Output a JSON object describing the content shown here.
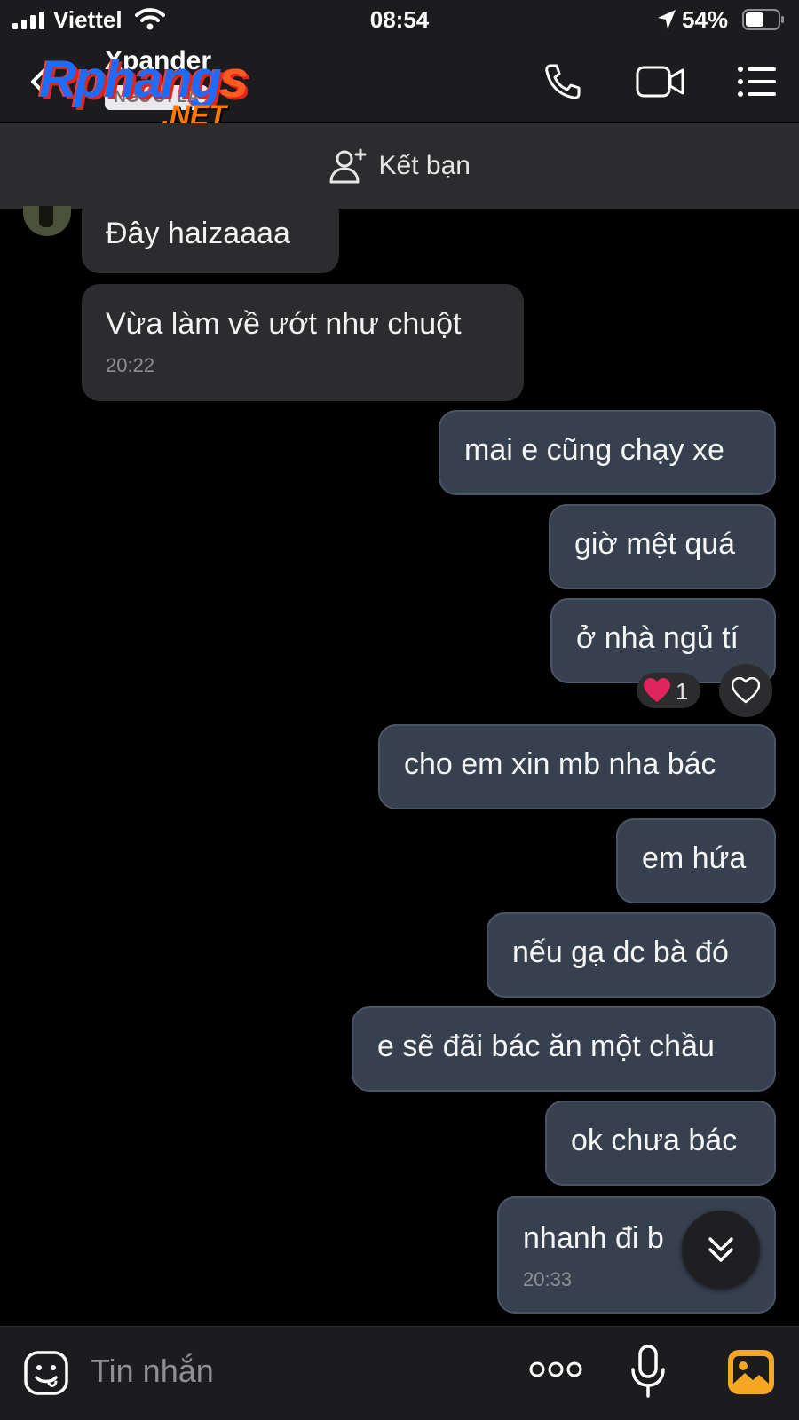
{
  "status_bar": {
    "carrier": "Viettel",
    "time": "08:54",
    "battery": "54%"
  },
  "header": {
    "contact_name": "Xpander",
    "stranger_badge": "NGƯỜI LẠ",
    "watermark": "Rphangs.NET"
  },
  "add_friend": {
    "label": "Kết bạn"
  },
  "messages": [
    {
      "side": "in",
      "text": "Đây haizaaaa"
    },
    {
      "side": "in",
      "text": "Vừa làm về ướt như chuột",
      "time": "20:22"
    },
    {
      "side": "out",
      "text": "mai e cũng chạy xe"
    },
    {
      "side": "out",
      "text": "giờ mệt quá"
    },
    {
      "side": "out",
      "text": "ở nhà ngủ tí"
    },
    {
      "side": "out",
      "text": "cho em xin mb nha bác"
    },
    {
      "side": "out",
      "text": "em hứa"
    },
    {
      "side": "out",
      "text": "nếu gạ dc bà đó"
    },
    {
      "side": "out",
      "text": "e sẽ đãi bác ăn một chầu"
    },
    {
      "side": "out",
      "text": "ok chưa bác"
    },
    {
      "side": "out",
      "text": "nhanh đi b",
      "time": "20:33"
    }
  ],
  "reaction": {
    "count": "1",
    "color": "#e0245e"
  },
  "input": {
    "placeholder": "Tin nhắn"
  },
  "colors": {
    "accent_orange": "#f5a623",
    "incoming_bubble": "#2c2c2e",
    "outgoing_bubble": "#37404f"
  },
  "icons": [
    "signal-icon",
    "wifi-icon",
    "location-arrow-icon",
    "battery-icon",
    "back-chevron-icon",
    "phone-icon",
    "video-camera-icon",
    "list-menu-icon",
    "add-user-icon",
    "heart-icon",
    "chevron-double-down-icon",
    "sticker-smile-icon",
    "more-dots-icon",
    "microphone-icon",
    "image-icon"
  ]
}
